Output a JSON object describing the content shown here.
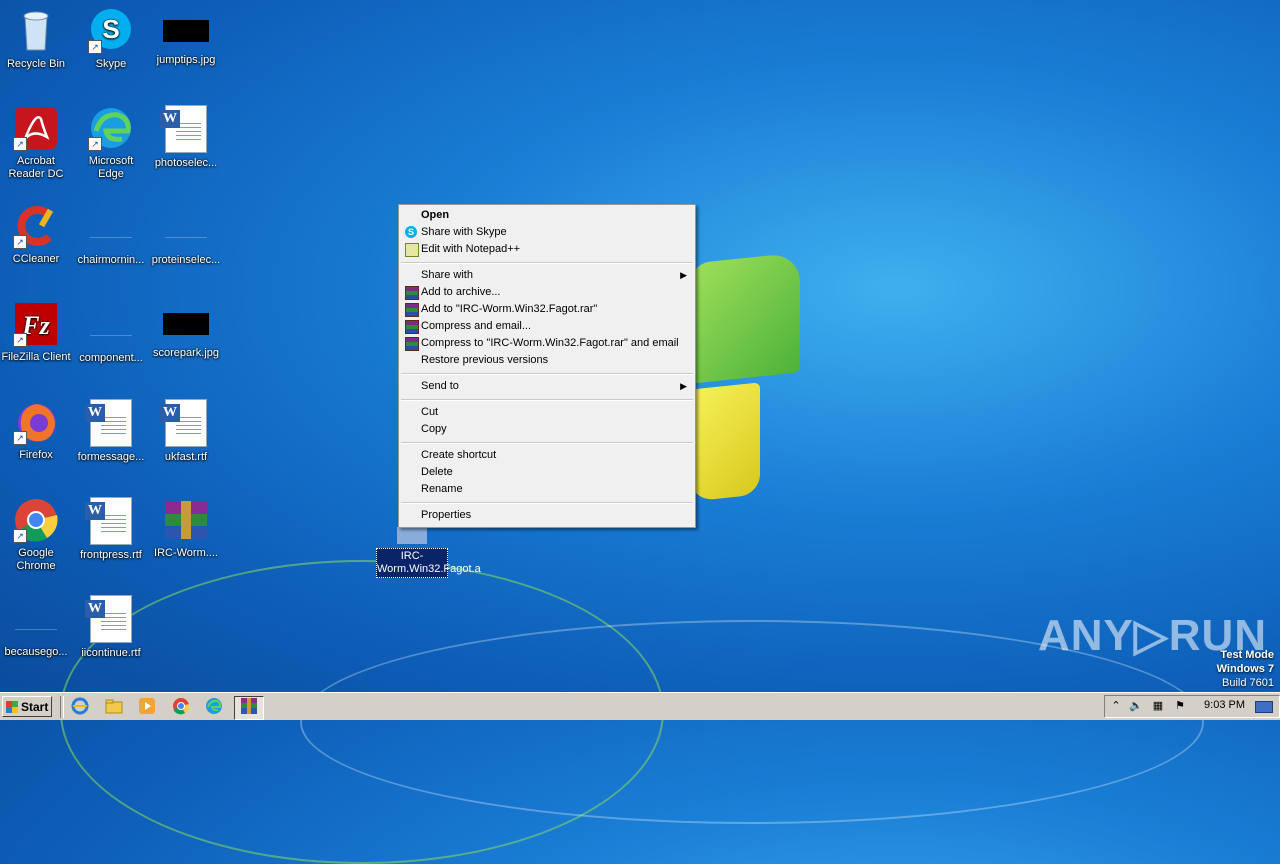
{
  "desktop": {
    "icons": [
      {
        "label": "Recycle Bin",
        "icon": "recycle-bin-icon"
      },
      {
        "label": "Skype",
        "icon": "skype-icon"
      },
      {
        "label": "jumptips.jpg",
        "icon": "image-file-icon"
      },
      {
        "label": "Acrobat Reader DC",
        "icon": "acrobat-icon"
      },
      {
        "label": "Microsoft Edge",
        "icon": "edge-icon"
      },
      {
        "label": "photoselec...",
        "icon": "word-doc-icon"
      },
      {
        "label": "CCleaner",
        "icon": "ccleaner-icon"
      },
      {
        "label": "chairmornin...",
        "icon": "file-icon"
      },
      {
        "label": "proteinselec...",
        "icon": "file-icon"
      },
      {
        "label": "FileZilla Client",
        "icon": "filezilla-icon"
      },
      {
        "label": "component...",
        "icon": "file-icon"
      },
      {
        "label": "scorepark.jpg",
        "icon": "image-file-icon"
      },
      {
        "label": "Firefox",
        "icon": "firefox-icon"
      },
      {
        "label": "formessage...",
        "icon": "word-doc-icon"
      },
      {
        "label": "ukfast.rtf",
        "icon": "word-doc-icon"
      },
      {
        "label": "Google Chrome",
        "icon": "chrome-icon"
      },
      {
        "label": "frontpress.rtf",
        "icon": "word-doc-icon"
      },
      {
        "label": "IRC-Worm....",
        "icon": "winrar-icon"
      },
      {
        "label": "becausego...",
        "icon": "file-icon"
      },
      {
        "label": "iicontinue.rtf",
        "icon": "word-doc-icon"
      }
    ],
    "selected_item_label": "IRC-Worm.Win32.Fagot.a"
  },
  "context_menu": {
    "items": [
      {
        "label": "Open",
        "bold": true
      },
      {
        "label": "Share with Skype",
        "icon": "skype-icon"
      },
      {
        "label": "Edit with Notepad++",
        "icon": "notepadpp-icon"
      },
      {
        "label": "Share with",
        "submenu": true
      },
      {
        "label": "Add to archive...",
        "icon": "winrar-icon"
      },
      {
        "label": "Add to \"IRC-Worm.Win32.Fagot.rar\"",
        "icon": "winrar-icon"
      },
      {
        "label": "Compress and email...",
        "icon": "winrar-icon"
      },
      {
        "label": "Compress to \"IRC-Worm.Win32.Fagot.rar\" and email",
        "icon": "winrar-icon"
      },
      {
        "label": "Restore previous versions"
      },
      {
        "label": "Send to",
        "submenu": true
      },
      {
        "label": "Cut"
      },
      {
        "label": "Copy"
      },
      {
        "label": "Create shortcut"
      },
      {
        "label": "Delete"
      },
      {
        "label": "Rename"
      },
      {
        "label": "Properties"
      }
    ],
    "submenu_arrow": "▶"
  },
  "watermark": {
    "brand": "ANY▷RUN",
    "line1": "Test Mode",
    "line2": "Windows 7",
    "line3": "Build 7601"
  },
  "taskbar": {
    "start_label": "Start",
    "clock": "9:03 PM",
    "pinned": [
      "ie-icon",
      "explorer-icon",
      "media-player-icon",
      "chrome-icon",
      "edge-icon",
      "winrar-icon"
    ]
  }
}
